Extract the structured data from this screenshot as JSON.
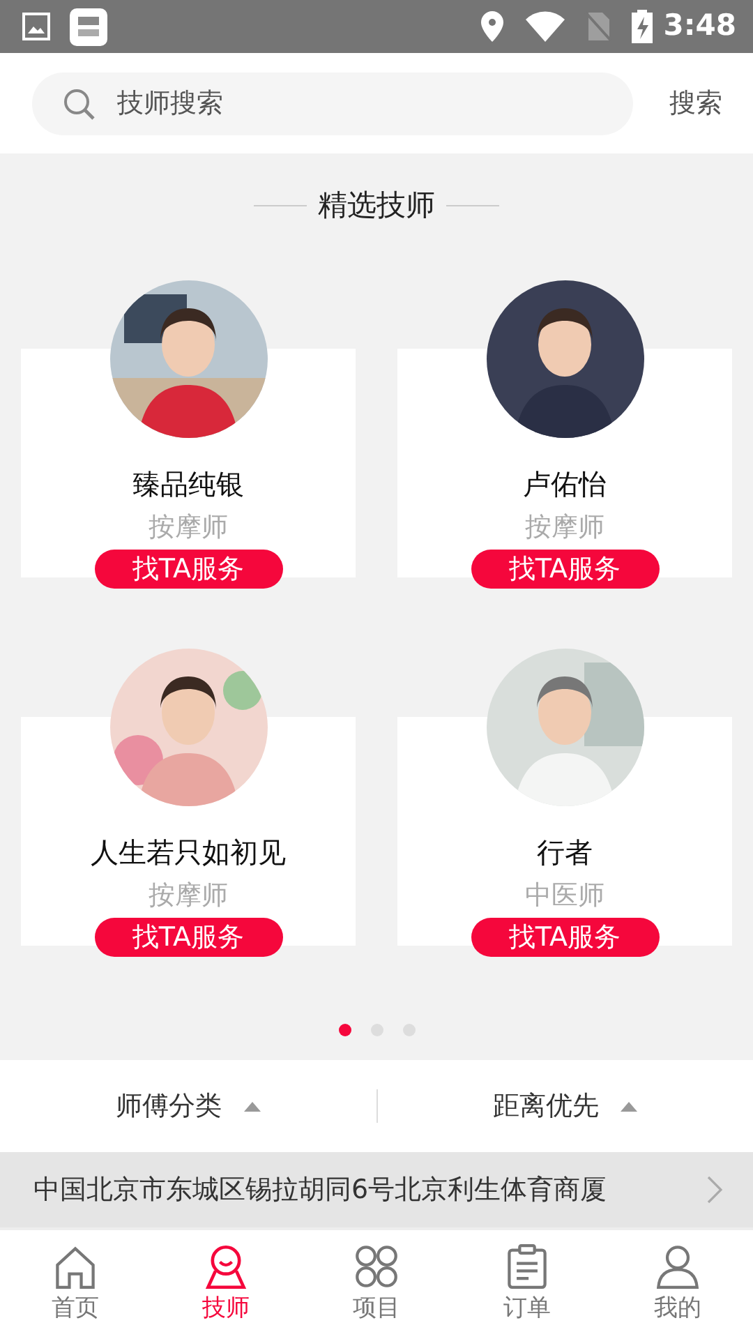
{
  "status_bar": {
    "time": "3:48"
  },
  "search": {
    "placeholder": "技师搜索",
    "button": "搜索"
  },
  "section_title": "精选技师",
  "technicians": [
    {
      "name": "臻品纯银",
      "role": "按摩师",
      "action": "找TA服务"
    },
    {
      "name": "卢佑怡",
      "role": "按摩师",
      "action": "找TA服务"
    },
    {
      "name": "人生若只如初见",
      "role": "按摩师",
      "action": "找TA服务"
    },
    {
      "name": "行者",
      "role": "中医师",
      "action": "找TA服务"
    }
  ],
  "pager": [
    {
      "selected": true
    },
    {
      "selected": false
    },
    {
      "selected": false
    }
  ],
  "filters": [
    {
      "label": "师傅分类"
    },
    {
      "label": "距离优先"
    }
  ],
  "address": "中国北京市东城区锡拉胡同6号北京利生体育商厦",
  "nav": [
    {
      "kind": "home",
      "label": "首页",
      "selected": false
    },
    {
      "kind": "tech",
      "label": "技师",
      "selected": true
    },
    {
      "kind": "items",
      "label": "项目",
      "selected": false
    },
    {
      "kind": "orders",
      "label": "订单",
      "selected": false
    },
    {
      "kind": "me",
      "label": "我的",
      "selected": false
    }
  ]
}
